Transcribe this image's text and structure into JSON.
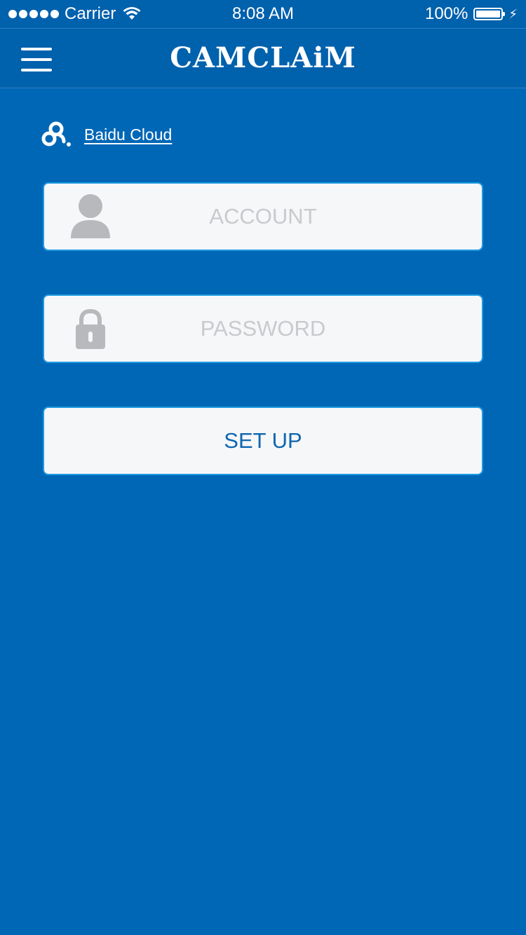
{
  "status_bar": {
    "carrier": "Carrier",
    "time": "8:08 AM",
    "battery": "100%"
  },
  "header": {
    "title": "CAMCLAiM"
  },
  "cloud": {
    "label": "Baidu Cloud",
    "icon": "baidu-cloud-icon"
  },
  "form": {
    "account_placeholder": "ACCOUNT",
    "account_icon": "user-icon",
    "password_placeholder": "PASSWORD",
    "password_icon": "lock-icon",
    "setup_label": "SET UP"
  },
  "colors": {
    "background": "#0067b6",
    "bar": "#0061ad",
    "field_border": "#1f9ae0",
    "field_bg": "#f6f7f9",
    "button_text": "#0f66b0",
    "placeholder": "#c8cacd",
    "icon_gray": "#b8b9bc"
  }
}
